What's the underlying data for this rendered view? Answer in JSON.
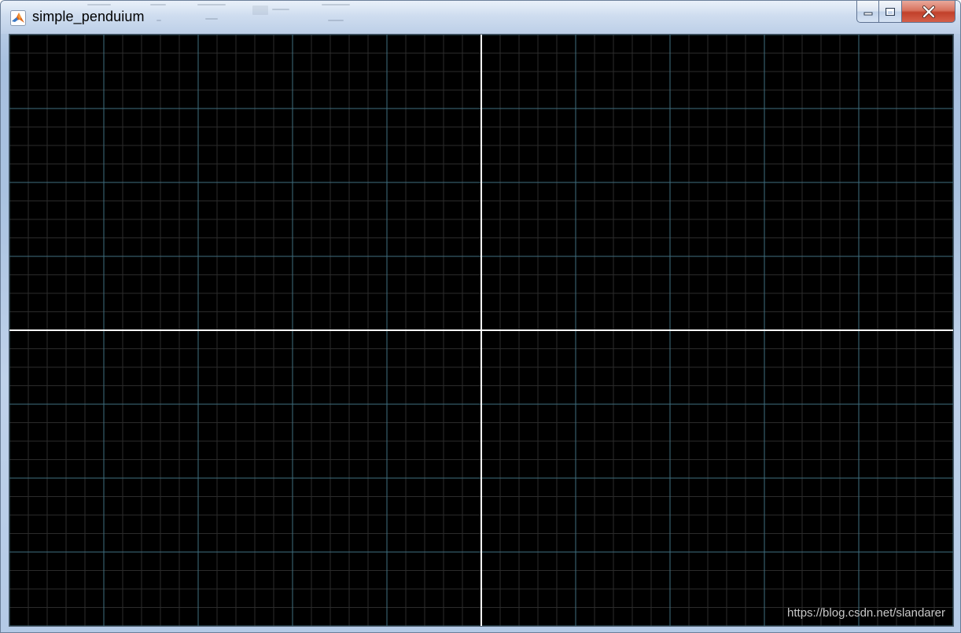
{
  "window": {
    "title": "simple_penduium",
    "app_icon": "matlab-logo-icon",
    "buttons": {
      "minimize": "minimize-icon",
      "maximize": "maximize-icon",
      "close": "close-icon"
    }
  },
  "figure": {
    "background_color": "#000000",
    "major_grid_color": "#3f6f80",
    "minor_grid_color": "#2b2b2b",
    "axis_color": "#ffffff",
    "grid": true,
    "axes_visible": true
  },
  "watermark": "https://blog.csdn.net/slandarer"
}
